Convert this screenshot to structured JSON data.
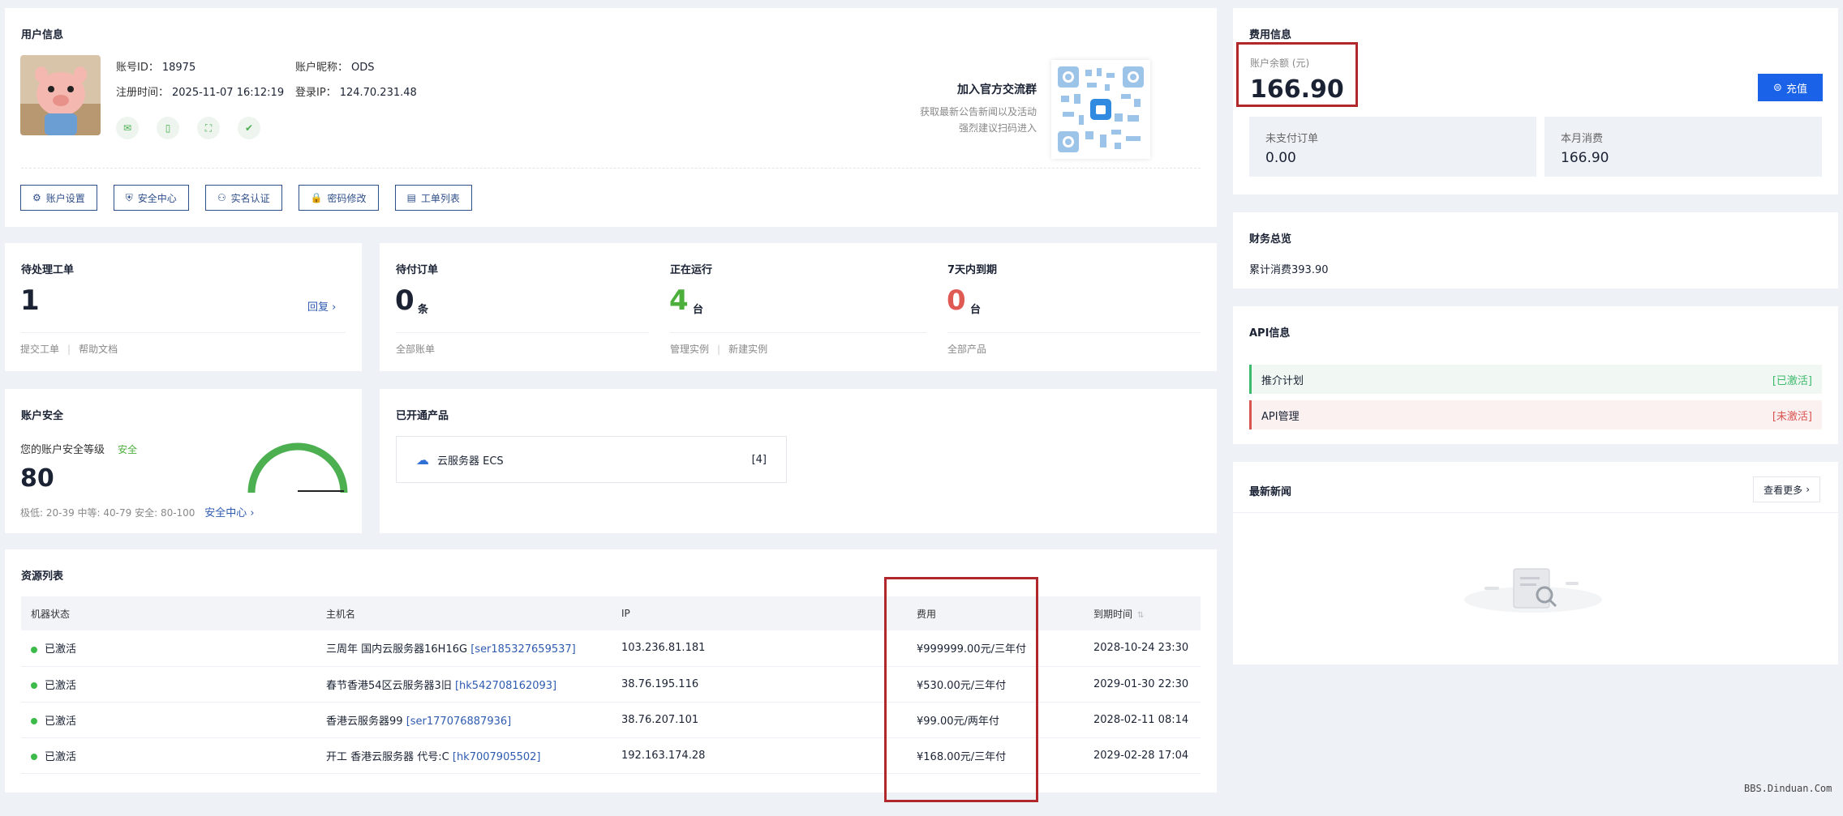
{
  "user": {
    "title": "用户信息",
    "account_id_label": "账号ID：",
    "account_id": "18975",
    "nickname_label": "账户昵称：",
    "nickname": "ODS",
    "reg_label": "注册时间：",
    "reg_time": "2025-11-07 16:12:19",
    "ip_label": "登录IP：",
    "login_ip": "124.70.231.48",
    "join_title": "加入官方交流群",
    "join_sub1": "获取最新公告新闻以及活动",
    "join_sub2": "强烈建议扫码进入",
    "buttons": [
      {
        "label": "账户设置",
        "icon": "gear-icon"
      },
      {
        "label": "安全中心",
        "icon": "shield-icon"
      },
      {
        "label": "实名认证",
        "icon": "user-icon"
      },
      {
        "label": "密码修改",
        "icon": "lock-icon"
      },
      {
        "label": "工单列表",
        "icon": "ticket-icon"
      }
    ]
  },
  "billing": {
    "title": "费用信息",
    "balance_label": "账户余额 (元)",
    "balance": "166.90",
    "recharge_label": "充值",
    "unpaid_label": "未支付订单",
    "unpaid": "0.00",
    "month_label": "本月消费",
    "month": "166.90"
  },
  "finance": {
    "title": "财务总览",
    "total": "累计消费393.90"
  },
  "api": {
    "title": "API信息",
    "items": [
      {
        "label": "推介计划",
        "status": "[已激活]",
        "color": "#3dbb6c"
      },
      {
        "label": "API管理",
        "status": "[未激活]",
        "color": "#d9534f"
      }
    ]
  },
  "news": {
    "title": "最新新闻",
    "more": "查看更多"
  },
  "ticket": {
    "title": "待处理工单",
    "count": "1",
    "reply": "回复",
    "link1": "提交工单",
    "link2": "帮助文档"
  },
  "orders": {
    "pending_title": "待付订单",
    "pending_count": "0",
    "pending_unit": "条",
    "pending_link": "全部账单",
    "running_title": "正在运行",
    "running_count": "4",
    "running_unit": "台",
    "running_link1": "管理实例",
    "running_link2": "新建实例",
    "expire_title": "7天内到期",
    "expire_count": "0",
    "expire_unit": "台",
    "expire_link": "全部产品"
  },
  "security": {
    "title": "账户安全",
    "level_label": "您的账户安全等级",
    "level": "安全",
    "score": "80",
    "legend": "极低: 20-39 中等: 40-79 安全: 80-100",
    "center": "安全中心",
    "score_fraction": 0.8
  },
  "products": {
    "title": "已开通产品",
    "name": "云服务器 ECS",
    "count": "[4]"
  },
  "resources": {
    "title": "资源列表",
    "headers": [
      "机器状态",
      "主机名",
      "IP",
      "费用",
      "到期时间"
    ],
    "rows": [
      {
        "status": "已激活",
        "host": "三周年 国内云服务器16H16G",
        "code": "[ser185327659537]",
        "ip": "103.236.81.181",
        "fee": "¥999999.00元/三年付",
        "expire": "2028-10-24 23:30"
      },
      {
        "status": "已激活",
        "host": "春节香港54区云服务器3旧",
        "code": "[hk542708162093]",
        "ip": "38.76.195.116",
        "fee": "¥530.00元/三年付",
        "expire": "2029-01-30 22:30"
      },
      {
        "status": "已激活",
        "host": "香港云服务器99",
        "code": "[ser177076887936]",
        "ip": "38.76.207.101",
        "fee": "¥99.00元/两年付",
        "expire": "2028-02-11 08:14"
      },
      {
        "status": "已激活",
        "host": "开工 香港云服务器 代号:C",
        "code": "[hk7007905502]",
        "ip": "192.163.174.28",
        "fee": "¥168.00元/三年付",
        "expire": "2029-02-28 17:04"
      }
    ]
  },
  "watermark": "BBS.Dinduan.Com",
  "colors": {
    "accent": "#1a62e8",
    "danger": "#d9534f",
    "success": "#3dbb4a"
  }
}
